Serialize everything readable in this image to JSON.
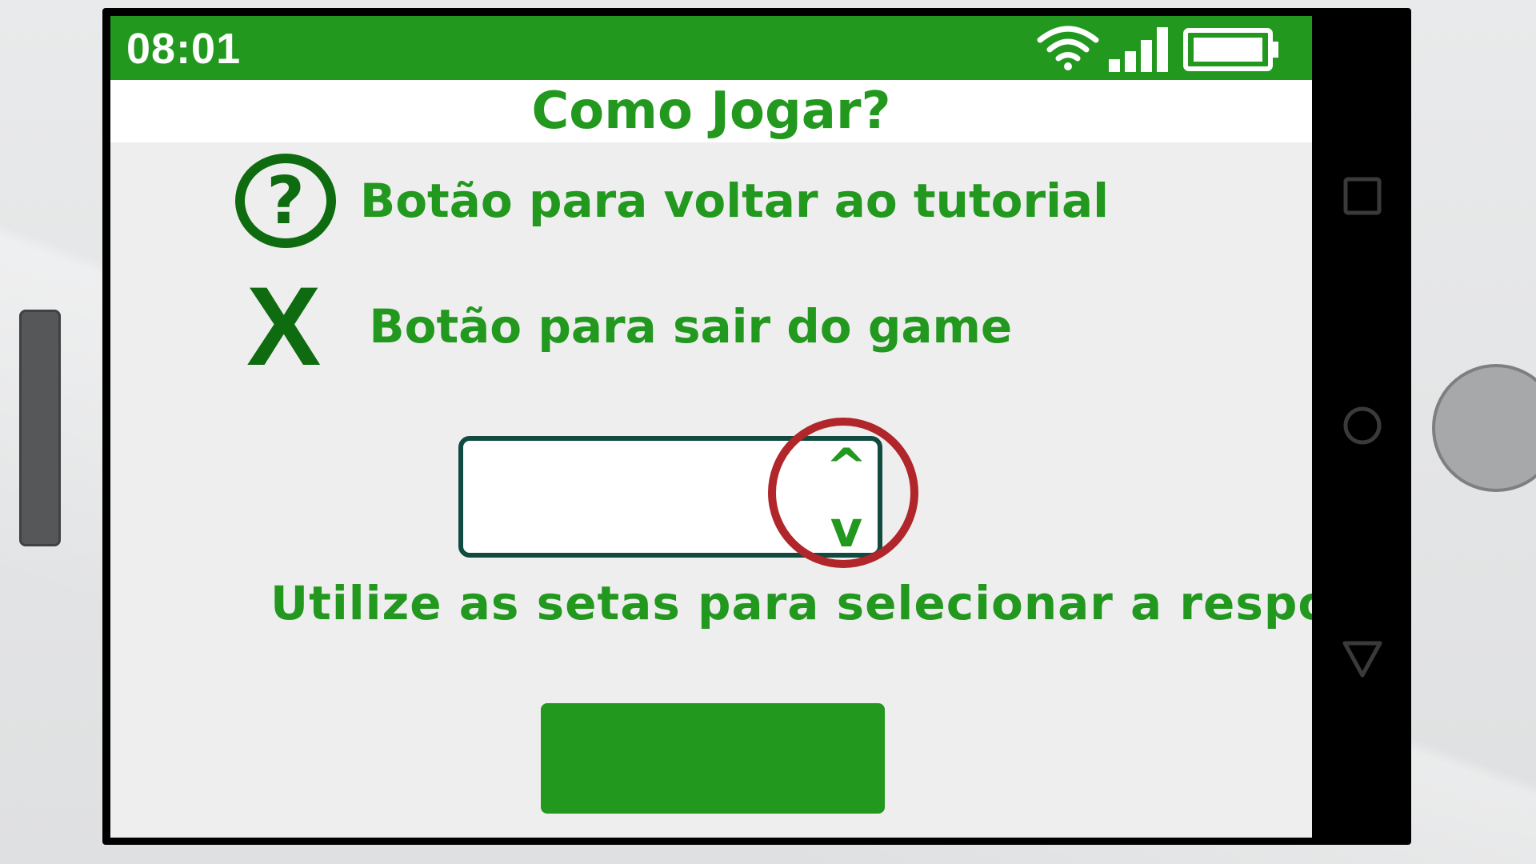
{
  "status_bar": {
    "time": "08:01",
    "icons": [
      "wifi-icon",
      "signal-icon",
      "battery-icon"
    ],
    "color": "#22981f"
  },
  "header": {
    "title": "Como Jogar?"
  },
  "legend": [
    {
      "icon": "help-circle-icon",
      "symbol": "?",
      "label": "Botão para voltar ao tutorial"
    },
    {
      "icon": "close-x-icon",
      "symbol": "X",
      "label": "Botão para sair do game"
    }
  ],
  "answer_selector": {
    "value": "",
    "up_symbol": "^",
    "down_symbol": "v",
    "highlight_color": "#b0262a"
  },
  "instruction": "Utilize as setas para selecionar a resposta",
  "action_button": {
    "label": "",
    "color": "#22981f"
  },
  "nav_bar": {
    "icons": [
      "recent-apps-icon",
      "home-icon",
      "back-icon"
    ]
  },
  "colors": {
    "accent": "#22981f",
    "dark_green": "#0e6b0f",
    "screen_bg": "#eeeeee"
  }
}
